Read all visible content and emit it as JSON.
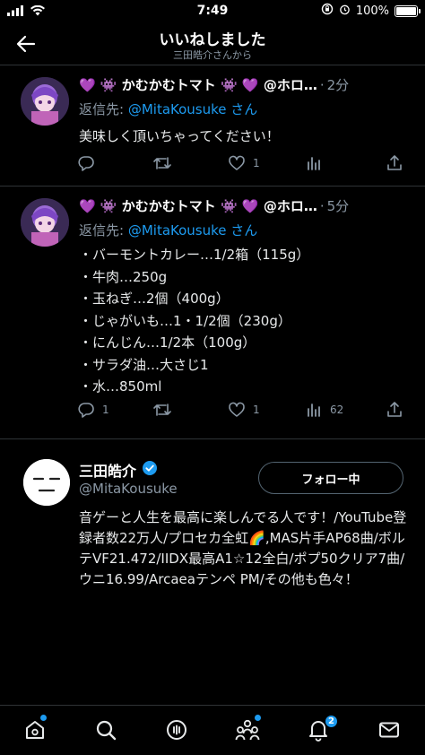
{
  "status_bar": {
    "time": "7:49",
    "battery": "100%"
  },
  "header": {
    "title": "いいねしました",
    "subtitle": "三田皓介さんから"
  },
  "tweets": [
    {
      "name": "💜 👾 かむかむトマト 👾 💜 @ホロ…",
      "time": "2分",
      "reply_prefix": "返信先: ",
      "reply_handle": "@MitaKousuke",
      "reply_suffix": " さん",
      "text": "美味しく頂いちゃってください！",
      "likes": "1",
      "retweets": "",
      "replies": "",
      "views": ""
    },
    {
      "name": "💜 👾 かむかむトマト 👾 💜 @ホロ…",
      "time": "5分",
      "reply_prefix": "返信先: ",
      "reply_handle": "@MitaKousuke",
      "reply_suffix": " さん",
      "text": "・バーモントカレー…1/2箱（115g）\n・牛肉…250g\n・玉ねぎ…2個（400g）\n・じゃがいも…1・1/2個（230g）\n・にんじん…1/2本（100g）\n・サラダ油…大さじ1\n・水…850ml",
      "replies": "1",
      "likes": "1",
      "views": "62",
      "retweets": ""
    }
  ],
  "profile": {
    "name": "三田皓介",
    "handle": "@MitaKousuke",
    "follow_label": "フォロー中",
    "bio": "音ゲーと人生を最高に楽しんでる人です！/YouTube登録者数22万人/プロセカ全虹🌈,MAS片手AP68曲/ボルテVF21.472/IIDX最高A1☆12全白/ポプ50クリア7曲/ウニ16.99/Arcaeaテンペ PM/その他も色々！"
  },
  "tab_bar": {
    "items": [
      "home-icon",
      "search-icon",
      "spaces-icon",
      "communities-icon",
      "notifications-icon",
      "messages-icon"
    ],
    "notification_badge": "2"
  },
  "colors": {
    "accent": "#1d9bf0",
    "background": "#000000",
    "muted": "#8b98a5"
  }
}
